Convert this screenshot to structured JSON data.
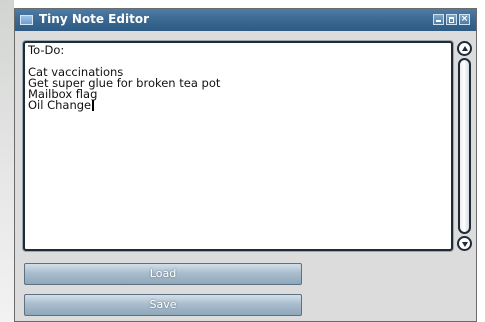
{
  "window": {
    "title": "Tiny Note Editor",
    "title_color": "#3a6891",
    "app_icon": "note-window-icon",
    "controls": [
      "minimize-icon",
      "maximize-icon",
      "close-icon"
    ]
  },
  "editor": {
    "content": "To-Do:\n\nCat vaccinations\nGet super glue for broken tea pot\nMailbox flag\nOil Change"
  },
  "buttons": {
    "load_label": "Load",
    "save_label": "Save"
  }
}
